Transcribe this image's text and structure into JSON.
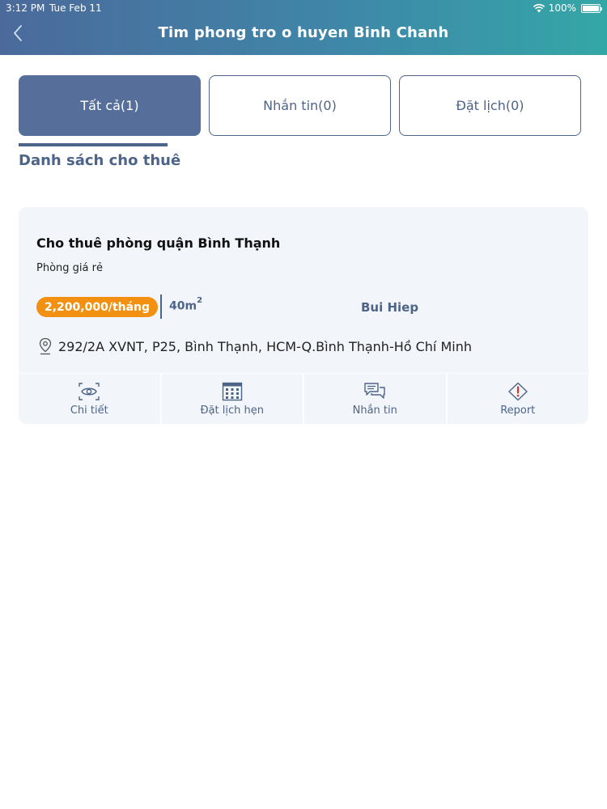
{
  "status_bar": {
    "time": "3:12 PM",
    "date": "Tue Feb 11",
    "battery": "100%"
  },
  "nav": {
    "title": "Tim phong tro o huyen Binh Chanh",
    "back_icon": "chevron-left-icon"
  },
  "tabs": [
    {
      "label": "Tất cả(1)",
      "active": true
    },
    {
      "label": "Nhắn tin(0)",
      "active": false
    },
    {
      "label": "Đặt lịch(0)",
      "active": false
    }
  ],
  "section": {
    "title": "Danh sách cho thuê"
  },
  "listing": {
    "title": "Cho thuê phòng quận Bình Thạnh",
    "subtitle": "Phòng giá rẻ",
    "price": "2,200,000/tháng",
    "area": "40m",
    "area_unit_sup": "2",
    "owner": "Bui Hiep",
    "address": "292/2A XVNT, P25, Bình Thạnh, HCM-Q.Bình Thạnh-Hồ Chí Minh",
    "actions": [
      {
        "label": "Chi tiết",
        "icon": "eye-icon"
      },
      {
        "label": "Đặt lịch hẹn",
        "icon": "calendar-icon"
      },
      {
        "label": "Nhắn tin",
        "icon": "chat-icon"
      },
      {
        "label": "Report",
        "icon": "warning-icon"
      }
    ]
  },
  "colors": {
    "primary": "#4d6489",
    "accent": "#f29111",
    "card_bg": "#f2f5f9"
  }
}
